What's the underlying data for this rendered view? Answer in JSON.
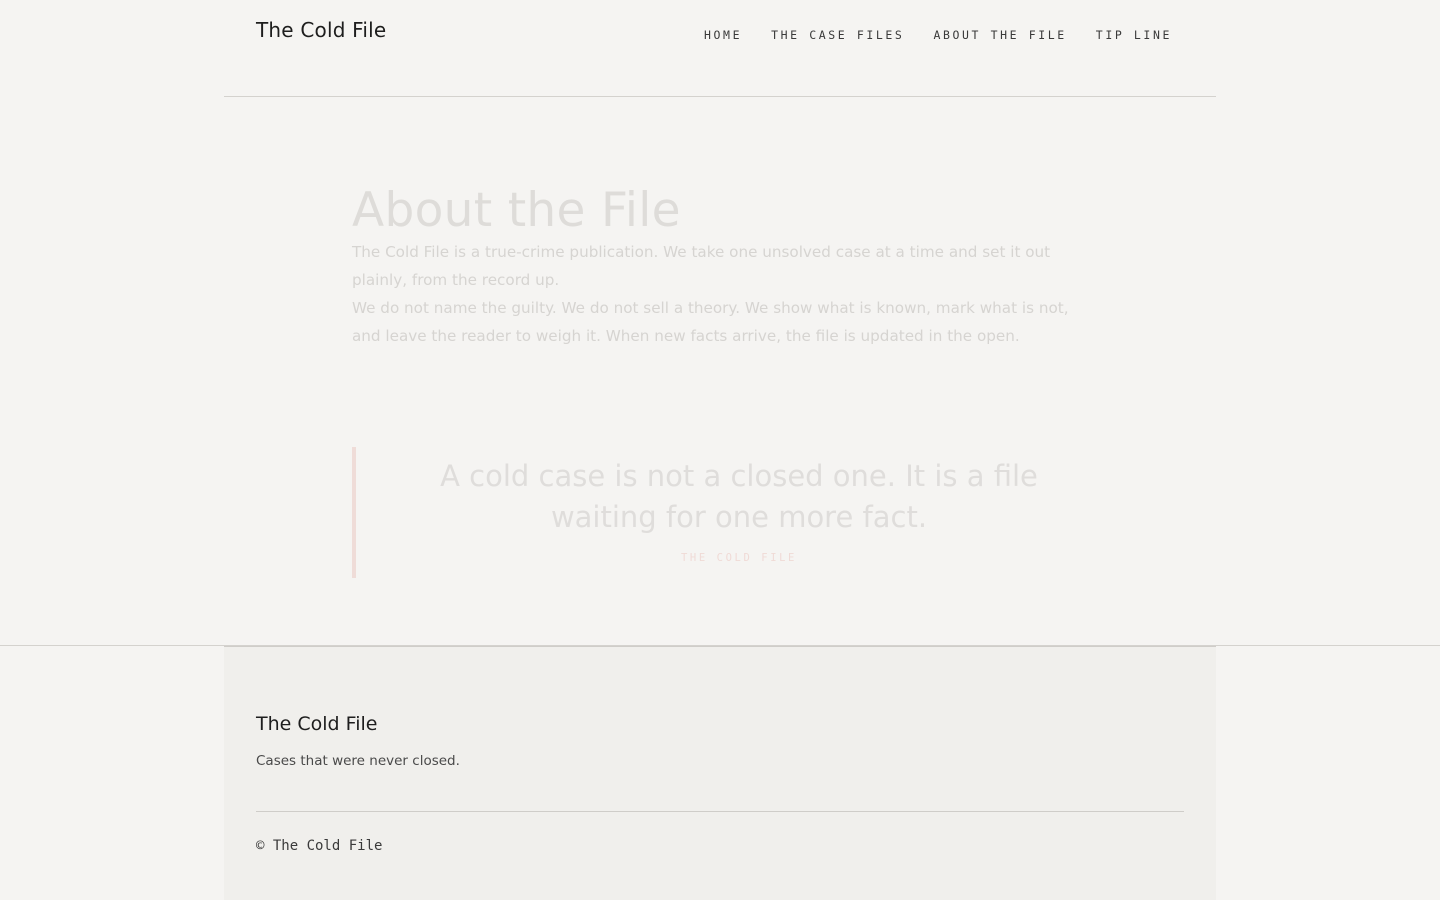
{
  "header": {
    "brand": "The Cold File",
    "nav": [
      {
        "label": "HOME"
      },
      {
        "label": "THE CASE FILES"
      },
      {
        "label": "ABOUT THE FILE"
      },
      {
        "label": "TIP LINE"
      }
    ]
  },
  "main": {
    "title": "About the File",
    "paragraphs": [
      "The Cold File is a true-crime publication. We take one unsolved case at a time and set it out plainly, from the record up.",
      "We do not name the guilty. We do not sell a theory. We show what is known, mark what is not, and leave the reader to weigh it. When new facts arrive, the file is updated in the open."
    ],
    "quote": {
      "text": "A cold case is not a closed one. It is a file waiting for one more fact.",
      "attribution": "THE COLD FILE"
    }
  },
  "footer": {
    "brand": "The Cold File",
    "tagline": "Cases that were never closed.",
    "copyright": "© The Cold File"
  },
  "colors": {
    "background": "#f5f4f2",
    "footer_background": "#f0efec",
    "quote_accent": "#efdcd8",
    "text_dark": "#1e1e1e"
  }
}
